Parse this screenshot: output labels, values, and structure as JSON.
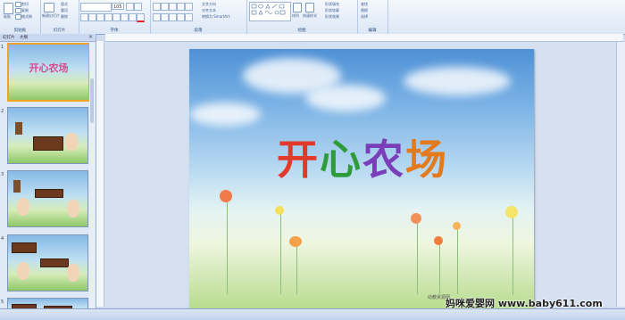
{
  "ribbon": {
    "groups": [
      "剪贴板",
      "幻灯片",
      "字体",
      "段落",
      "绘图",
      "编辑"
    ],
    "clipboard": {
      "paste": "粘贴",
      "cut": "剪切",
      "copy": "复制",
      "format_painter": "格式刷"
    },
    "slides": {
      "new_slide": "新建幻灯片",
      "layout": "版式",
      "reset": "重设",
      "delete": "删除"
    },
    "font": {
      "size": "105"
    },
    "paragraph": {
      "text_direction": "文字方向",
      "align_text": "对齐文本",
      "smartart": "转换为 SmartArt"
    },
    "drawing": {
      "arrange": "排列",
      "quick_styles": "快速样式",
      "fill": "形状填充",
      "outline": "形状轮廓",
      "effects": "形状效果"
    },
    "editing": {
      "find": "查找",
      "replace": "替换",
      "select": "选择"
    }
  },
  "panel": {
    "tabs": [
      "幻灯片",
      "大纲"
    ],
    "slide_numbers": [
      "1",
      "2",
      "3",
      "4",
      "5"
    ]
  },
  "slide": {
    "title_chars": [
      "开",
      "心",
      "农",
      "场"
    ],
    "title_colors": [
      "#e03a2a",
      "#2f9c3c",
      "#7a3fb8",
      "#e27b1e"
    ],
    "thumb_title": "开心农场",
    "caption": "幼教资源网"
  },
  "watermark": "妈咪爱婴网 www.baby611.com"
}
